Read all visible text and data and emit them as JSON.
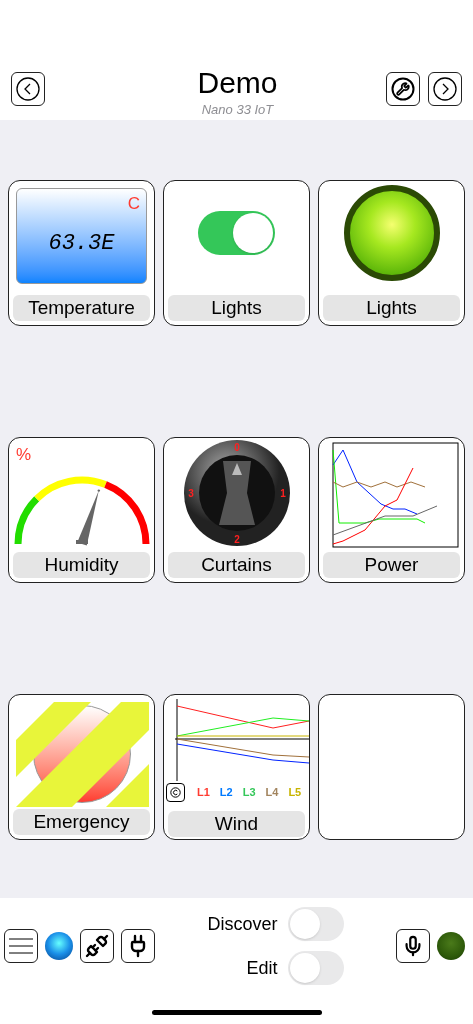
{
  "header": {
    "title": "Demo",
    "subtitle": "Nano 33 IoT"
  },
  "tiles": [
    {
      "kind": "display",
      "label": "Temperature",
      "value": "63.3E",
      "unit": "C"
    },
    {
      "kind": "switch",
      "label": "Lights",
      "on": true
    },
    {
      "kind": "lamp",
      "label": "Lights",
      "on": true
    },
    {
      "kind": "gauge",
      "label": "Humidity",
      "unit": "%",
      "level": 0.62
    },
    {
      "kind": "knob",
      "label": "Curtains",
      "marks": [
        "0",
        "1",
        "2",
        "3"
      ]
    },
    {
      "kind": "plot",
      "label": "Power"
    },
    {
      "kind": "push",
      "label": "Emergency",
      "locked": true
    },
    {
      "kind": "legend_plot",
      "label": "Wind",
      "legend": [
        {
          "text": "L1",
          "color": "#ff3b30"
        },
        {
          "text": "L2",
          "color": "#007aff"
        },
        {
          "text": "L3",
          "color": "#34c759"
        },
        {
          "text": "L4",
          "color": "#a2845e"
        },
        {
          "text": "L5",
          "color": "#c8b400"
        }
      ]
    },
    {
      "kind": "empty"
    }
  ],
  "toolbar": {
    "toggles": [
      {
        "label": "Discover",
        "on": false
      },
      {
        "label": "Edit",
        "on": false
      }
    ]
  }
}
